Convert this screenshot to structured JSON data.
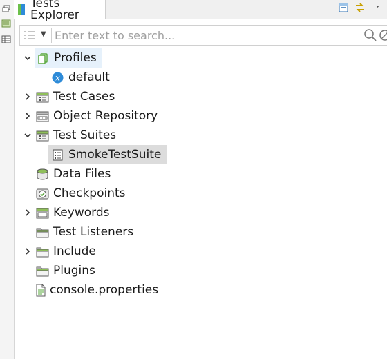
{
  "window": {
    "tab_title": "Tests Explorer"
  },
  "search": {
    "placeholder": "Enter text to search..."
  },
  "tree": {
    "items": [
      {
        "label": "Profiles",
        "icon": "profiles-icon",
        "expanded": true
      },
      {
        "label": "default",
        "icon": "profile-variable-icon"
      },
      {
        "label": "Test Cases",
        "icon": "test-cases-folder-icon",
        "expanded": false
      },
      {
        "label": "Object Repository",
        "icon": "object-repository-icon",
        "expanded": false
      },
      {
        "label": "Test Suites",
        "icon": "test-suites-folder-icon",
        "expanded": true
      },
      {
        "label": "SmokeTestSuite",
        "icon": "test-suite-icon",
        "selected": true
      },
      {
        "label": "Data Files",
        "icon": "data-files-icon"
      },
      {
        "label": "Checkpoints",
        "icon": "checkpoints-icon"
      },
      {
        "label": "Keywords",
        "icon": "keywords-folder-icon",
        "expanded": false
      },
      {
        "label": "Test Listeners",
        "icon": "folder-icon"
      },
      {
        "label": "Include",
        "icon": "folder-icon",
        "expanded": false
      },
      {
        "label": "Plugins",
        "icon": "folder-icon"
      },
      {
        "label": "console.properties",
        "icon": "file-icon"
      }
    ]
  },
  "colors": {
    "accent_blue": "#2e8bd8",
    "folder_green": "#8fbf5a",
    "selection_light": "#e6f1fb",
    "selection_grey": "#dcdcdc"
  }
}
